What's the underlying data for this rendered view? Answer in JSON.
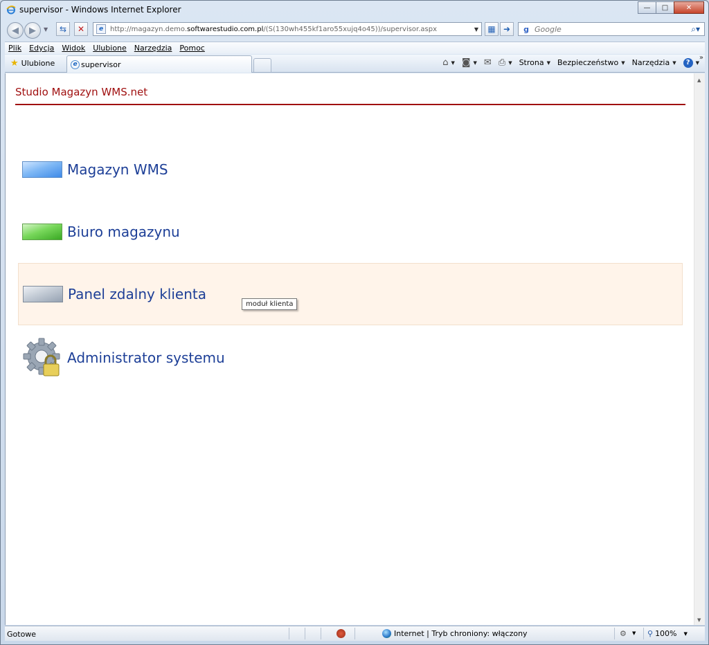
{
  "window": {
    "title": "supervisor - Windows Internet Explorer",
    "buttons": {
      "minimize": "—",
      "maximize": "□",
      "close": "✕"
    }
  },
  "address_bar": {
    "url_prefix": "http://magazyn.demo.",
    "url_domain": "softwarestudio.com.pl",
    "url_suffix": "/(S(130wh455kf1aro55xujq4o45))/supervisor.aspx"
  },
  "search": {
    "placeholder": "Google"
  },
  "menu": {
    "items": [
      {
        "label": "Plik",
        "accel": "P"
      },
      {
        "label": "Edycja",
        "accel": "E"
      },
      {
        "label": "Widok",
        "accel": "W"
      },
      {
        "label": "Ulubione",
        "accel": "U"
      },
      {
        "label": "Narzędzia",
        "accel": "N"
      },
      {
        "label": "Pomoc",
        "accel": "o"
      }
    ]
  },
  "favorites": {
    "label": "Ulubione"
  },
  "tab": {
    "title": "supervisor"
  },
  "command_bar": {
    "page": "Strona",
    "safety": "Bezpieczeństwo",
    "tools": "Narzędzia"
  },
  "page": {
    "header": "Studio Magazyn WMS.net",
    "header_color": "#a01010",
    "modules": [
      {
        "label": "Magazyn WMS",
        "color": "blue"
      },
      {
        "label": "Biuro magazynu",
        "color": "green"
      },
      {
        "label": "Panel zdalny klienta",
        "color": "gray",
        "hovered": true
      },
      {
        "label": "Administrator systemu",
        "icon": "gear-lock-icon"
      }
    ],
    "tooltip": "moduł klienta",
    "link_color": "#1d3f97",
    "hover_background": "#fff4ea"
  },
  "status_bar": {
    "status": "Gotowe",
    "zone": "Internet | Tryb chroniony: włączony",
    "zoom": "100%"
  }
}
